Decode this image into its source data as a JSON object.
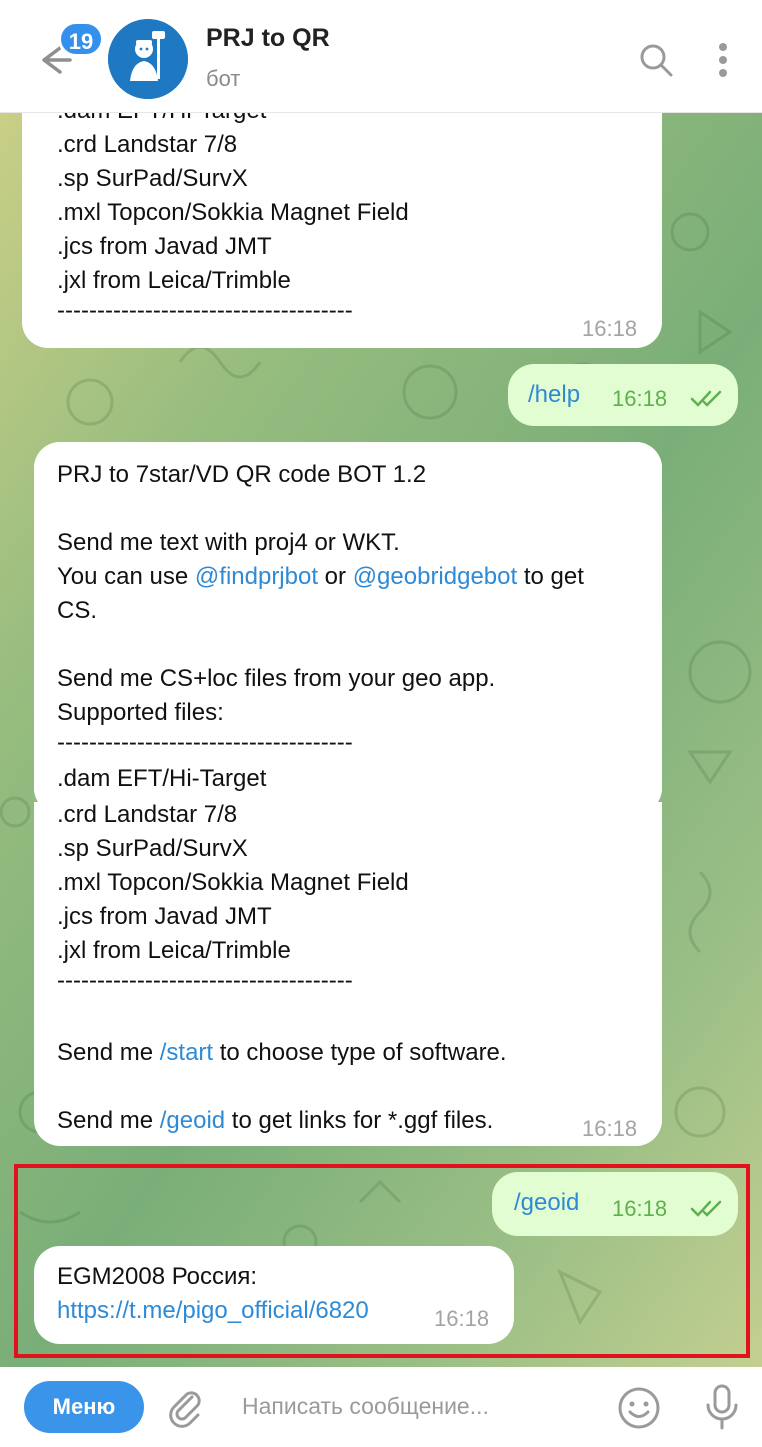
{
  "header": {
    "badge_count": "19",
    "title": "PRJ to QR",
    "subtitle": "бот"
  },
  "messages": {
    "msg1": {
      "lines": [
        ".dam EFT/Hi-Target",
        ".crd Landstar 7/8",
        ".sp SurPad/SurvX",
        ".mxl Topcon/Sokkia Magnet Field",
        ".jcs from Javad JMT",
        ".jxl from Leica/Trimble",
        "-------------------------------------"
      ],
      "time": "16:18"
    },
    "msg2": {
      "text": "/help",
      "time": "16:18"
    },
    "msg3": {
      "l1": "PRJ to 7star/VD QR code BOT 1.2",
      "l3": "Send me text with proj4 or WKT.",
      "l4a": "You can use ",
      "l4b": "@findprjbot",
      "l4c": " or ",
      "l4d": "@geobridgebot",
      "l4e": " to get",
      "l5": "CS.",
      "l7": "Send me CS+loc files from your geo app.",
      "l8": "Supported files:",
      "l9": "-------------------------------------",
      "l10": ".dam EFT/Hi-Target",
      "l11": ".crd Landstar 7/8",
      "l12": ".sp SurPad/SurvX",
      "l13": ".mxl Topcon/Sokkia Magnet Field",
      "l14": ".jcs from Javad JMT",
      "l15": ".jxl from Leica/Trimble",
      "l16": "-------------------------------------",
      "l18a": "Send me ",
      "l18b": "/start",
      "l18c": " to choose type of software.",
      "l20a": "Send me ",
      "l20b": "/geoid",
      "l20c": " to get links for *.ggf files.",
      "time": "16:18"
    },
    "msg4": {
      "text": "/geoid",
      "time": "16:18"
    },
    "msg5": {
      "line1": "EGM2008 Россия:",
      "link": "https://t.me/pigo_official/6820",
      "time": "16:18"
    }
  },
  "input": {
    "menu_label": "Меню",
    "placeholder": "Написать сообщение..."
  },
  "colors": {
    "accent": "#3390ec",
    "outgoing_bubble": "#e3fdd2",
    "highlight": "#e1121e"
  }
}
